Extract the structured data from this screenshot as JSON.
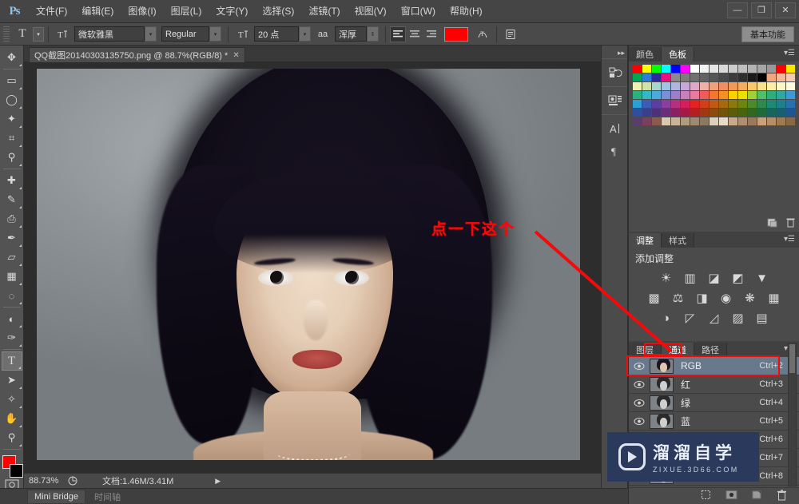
{
  "app": {
    "logo": "Ps"
  },
  "menubar": {
    "items": [
      {
        "label": "文件(F)"
      },
      {
        "label": "编辑(E)"
      },
      {
        "label": "图像(I)"
      },
      {
        "label": "图层(L)"
      },
      {
        "label": "文字(Y)"
      },
      {
        "label": "选择(S)"
      },
      {
        "label": "滤镜(T)"
      },
      {
        "label": "视图(V)"
      },
      {
        "label": "窗口(W)"
      },
      {
        "label": "帮助(H)"
      }
    ],
    "window_controls": {
      "minimize": "—",
      "maximize": "❐",
      "close": "✕"
    }
  },
  "optionsbar": {
    "tool_icon": "T",
    "orientation_icon": "text-orientation-icon",
    "font_family": "微软雅黑",
    "font_style": "Regular",
    "size_icon": "font-size-icon",
    "font_size": "20 点",
    "aa_icon": "aa",
    "anti_alias": "浑厚",
    "align_left": "align-left",
    "align_center": "align-center",
    "align_right": "align-right",
    "text_color": "#ff0000",
    "warp_icon": "warp-text-icon",
    "panel_icon": "char-panel-icon",
    "workspace": "基本功能"
  },
  "toolbar": {
    "tools": [
      {
        "name": "move-tool",
        "glyph": "✥"
      },
      {
        "name": "marquee-tool",
        "glyph": "▭"
      },
      {
        "name": "lasso-tool",
        "glyph": "◯"
      },
      {
        "name": "magic-wand-tool",
        "glyph": "✦"
      },
      {
        "name": "crop-tool",
        "glyph": "⌗"
      },
      {
        "name": "eyedropper-tool",
        "glyph": "⚲"
      },
      {
        "name": "healing-brush-tool",
        "glyph": "✚"
      },
      {
        "name": "brush-tool",
        "glyph": "✎"
      },
      {
        "name": "clone-stamp-tool",
        "glyph": "⎙"
      },
      {
        "name": "history-brush-tool",
        "glyph": "✒"
      },
      {
        "name": "eraser-tool",
        "glyph": "▱"
      },
      {
        "name": "gradient-tool",
        "glyph": "▦"
      },
      {
        "name": "blur-tool",
        "glyph": "◌"
      },
      {
        "name": "dodge-tool",
        "glyph": "◐"
      },
      {
        "name": "pen-tool",
        "glyph": "✑"
      },
      {
        "name": "type-tool",
        "glyph": "T",
        "selected": true
      },
      {
        "name": "path-selection-tool",
        "glyph": "➤"
      },
      {
        "name": "shape-tool",
        "glyph": "✧"
      },
      {
        "name": "hand-tool",
        "glyph": "✋"
      },
      {
        "name": "zoom-tool",
        "glyph": "⚲"
      }
    ],
    "foreground_color": "#ff0000",
    "background_color": "#000000",
    "quickmask_icon": "quick-mask-icon",
    "screenmode_icon": "screen-mode-icon"
  },
  "document": {
    "tab_title": "QQ截图20140303135750.png @ 88.7%(RGB/8) *",
    "close": "✕"
  },
  "annotation": {
    "text": "点一下这个",
    "color": "#f90808"
  },
  "statusbar": {
    "zoom": "88.73%",
    "doc_icon": "doc-info-icon",
    "doc_info": "文档:1.46M/3.41M",
    "arrow": "▶"
  },
  "bottombar": {
    "tabs": [
      {
        "label": "Mini Bridge",
        "active": true
      },
      {
        "label": "时间轴",
        "active": false
      }
    ]
  },
  "icondock": {
    "collapse": "▸▸",
    "groups": [
      {
        "icons": [
          {
            "name": "history-icon",
            "glyph": "↺"
          }
        ]
      },
      {
        "icons": [
          {
            "name": "mini-bridge-icon",
            "glyph": "▤"
          }
        ]
      },
      {
        "icons": [
          {
            "name": "character-icon",
            "glyph": "A"
          },
          {
            "name": "paragraph-icon",
            "glyph": "¶"
          }
        ]
      }
    ]
  },
  "color_panel": {
    "tabs": [
      {
        "label": "颜色",
        "active": false
      },
      {
        "label": "色板",
        "active": true
      }
    ],
    "menu_icon": "panel-menu-icon",
    "swatch_rows": [
      [
        "#ff0000",
        "#ffff00",
        "#00ff00",
        "#00ffff",
        "#0000ff",
        "#ff00ff",
        "#ffffff",
        "#f2f2f2",
        "#e6e6e6",
        "#d9d9d9",
        "#cccccc",
        "#bfbfbf",
        "#b3b3b3",
        "#a6a6a6",
        "#999999",
        "#ff0000",
        "#ffe400"
      ],
      [
        "#00a651",
        "#2a7fd4",
        "#2b2b9e",
        "#e8117f",
        "#8a8a8a",
        "#7d7d7d",
        "#707070",
        "#636363",
        "#565656",
        "#494949",
        "#3c3c3c",
        "#2f2f2f",
        "#1a1a1a",
        "#000000",
        "#f0a67f",
        "#f3b79a",
        "#f6c9b2"
      ],
      [
        "#eef0b4",
        "#cfe3a8",
        "#a8d6cf",
        "#9fc4e6",
        "#b0b6e0",
        "#c7a8d9",
        "#e0a8c4",
        "#efb0a8",
        "#f0a07a",
        "#ef8f63",
        "#f09a57",
        "#f3ad5c",
        "#f7c96a",
        "#f9e08a",
        "#fbefa8",
        "#fdf7c8",
        "#fffbe0"
      ],
      [
        "#29b27f",
        "#34b8c4",
        "#4fa9dd",
        "#7b8fd4",
        "#9d7ec9",
        "#c97fb8",
        "#e8799f",
        "#ef5a5a",
        "#f3762f",
        "#f59024",
        "#fdd000",
        "#e9e100",
        "#9ed13a",
        "#4fbf6a",
        "#2bb07c",
        "#2fa9a0",
        "#3e9ad4"
      ],
      [
        "#2e9ed6",
        "#3f5bb5",
        "#5a3f9e",
        "#8a3f9e",
        "#b5307f",
        "#d41f5c",
        "#e52222",
        "#cf3f1a",
        "#c05a16",
        "#a5690f",
        "#8a7a0d",
        "#6d840f",
        "#4d8a2a",
        "#2b8a4d",
        "#1f8a72",
        "#1f7f8a",
        "#2a6fae"
      ],
      [
        "#2f4f9e",
        "#3a3f8a",
        "#4e2f7a",
        "#6a2f7a",
        "#8a2060",
        "#a61b45",
        "#b51f1f",
        "#a13713",
        "#8a4a10",
        "#73540c",
        "#5c5c0b",
        "#49640c",
        "#33661f",
        "#1f6b3c",
        "#17665c",
        "#176070",
        "#1f5590"
      ],
      [
        "#5a3d6b",
        "#7a3f5e",
        "#8a5a4d",
        "#d9c9b0",
        "#c9b49a",
        "#b09a80",
        "#9e8a70",
        "#8a7a60",
        "#ddd0bd",
        "#e8dcc8",
        "#caa98a",
        "#b08f6e",
        "#9a7a5a",
        "#caa07a",
        "#b58d66",
        "#9e7a52",
        "#8a6a44"
      ]
    ],
    "footer_new_icon": "new-swatch-icon",
    "footer_delete_icon": "delete-swatch-icon"
  },
  "adjustments_panel": {
    "tabs": [
      {
        "label": "调整",
        "active": true
      },
      {
        "label": "样式",
        "active": false
      }
    ],
    "menu_icon": "panel-menu-icon",
    "title": "添加调整",
    "rows": [
      [
        {
          "name": "brightness-contrast-icon",
          "glyph": "☀"
        },
        {
          "name": "levels-icon",
          "glyph": "▥"
        },
        {
          "name": "curves-icon",
          "glyph": "◪"
        },
        {
          "name": "exposure-icon",
          "glyph": "◩"
        },
        {
          "name": "vibrance-icon",
          "glyph": "▼"
        }
      ],
      [
        {
          "name": "hue-saturation-icon",
          "glyph": "▩"
        },
        {
          "name": "color-balance-icon",
          "glyph": "⚖"
        },
        {
          "name": "black-white-icon",
          "glyph": "◨"
        },
        {
          "name": "photo-filter-icon",
          "glyph": "◉"
        },
        {
          "name": "channel-mixer-icon",
          "glyph": "❋"
        },
        {
          "name": "color-lookup-icon",
          "glyph": "▦"
        }
      ],
      [
        {
          "name": "invert-icon",
          "glyph": "◑"
        },
        {
          "name": "posterize-icon",
          "glyph": "◸"
        },
        {
          "name": "threshold-icon",
          "glyph": "◿"
        },
        {
          "name": "selective-color-icon",
          "glyph": "▨"
        },
        {
          "name": "gradient-map-icon",
          "glyph": "▤"
        }
      ]
    ]
  },
  "channels_panel": {
    "tabs": [
      {
        "label": "图层",
        "active": false
      },
      {
        "label": "通道",
        "active": true
      },
      {
        "label": "路径",
        "active": false
      }
    ],
    "menu_icon": "panel-menu-icon",
    "rows": [
      {
        "name": "RGB",
        "shortcut": "Ctrl+2",
        "selected": true,
        "thumb": "color",
        "visible": true
      },
      {
        "name": "红",
        "shortcut": "Ctrl+3",
        "selected": false,
        "thumb": "gray",
        "visible": true
      },
      {
        "name": "绿",
        "shortcut": "Ctrl+4",
        "selected": false,
        "thumb": "gray",
        "visible": true
      },
      {
        "name": "蓝",
        "shortcut": "Ctrl+5",
        "selected": false,
        "thumb": "gray",
        "visible": true
      },
      {
        "name": "",
        "shortcut": "Ctrl+6",
        "selected": false,
        "thumb": "gray",
        "visible": true
      },
      {
        "name": "",
        "shortcut": "Ctrl+7",
        "selected": false,
        "thumb": "gray",
        "visible": true
      },
      {
        "name": "",
        "shortcut": "Ctrl+8",
        "selected": false,
        "thumb": "gray",
        "visible": true
      }
    ],
    "footer_icons": [
      {
        "name": "load-channel-as-selection-icon",
        "glyph": "⬚"
      },
      {
        "name": "save-selection-as-channel-icon",
        "glyph": "◉"
      },
      {
        "name": "new-channel-icon",
        "glyph": "◰"
      },
      {
        "name": "delete-channel-icon",
        "glyph": "🗑"
      }
    ],
    "scroll_up": "▲",
    "scroll_down": "▼"
  },
  "watermark": {
    "title": "溜溜自学",
    "url": "ZIXUE.3D66.COM",
    "logo": "play-logo-icon",
    "bg": "#2b3a5c"
  }
}
